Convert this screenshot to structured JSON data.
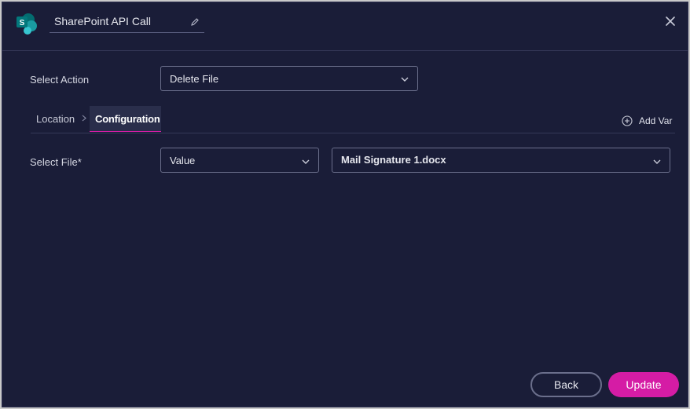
{
  "header": {
    "title": "SharePoint API Call",
    "app_icon": "sharepoint-logo",
    "edit_icon": "pencil-icon",
    "close_icon": "close-icon"
  },
  "select_action": {
    "label": "Select Action",
    "value": "Delete File"
  },
  "tabs": {
    "location_label": "Location",
    "configuration_label": "Configuration",
    "active": "Configuration",
    "separator_icon": "chevron-right-icon"
  },
  "add_var": {
    "label": "Add Var",
    "icon": "plus-circle-icon"
  },
  "select_file": {
    "label": "Select File*",
    "type_value": "Value",
    "file_value": "Mail Signature 1.docx"
  },
  "footer": {
    "back_label": "Back",
    "update_label": "Update"
  },
  "colors": {
    "background": "#1a1d38",
    "accent": "#d51ca5",
    "border": "#6b6f8c"
  }
}
